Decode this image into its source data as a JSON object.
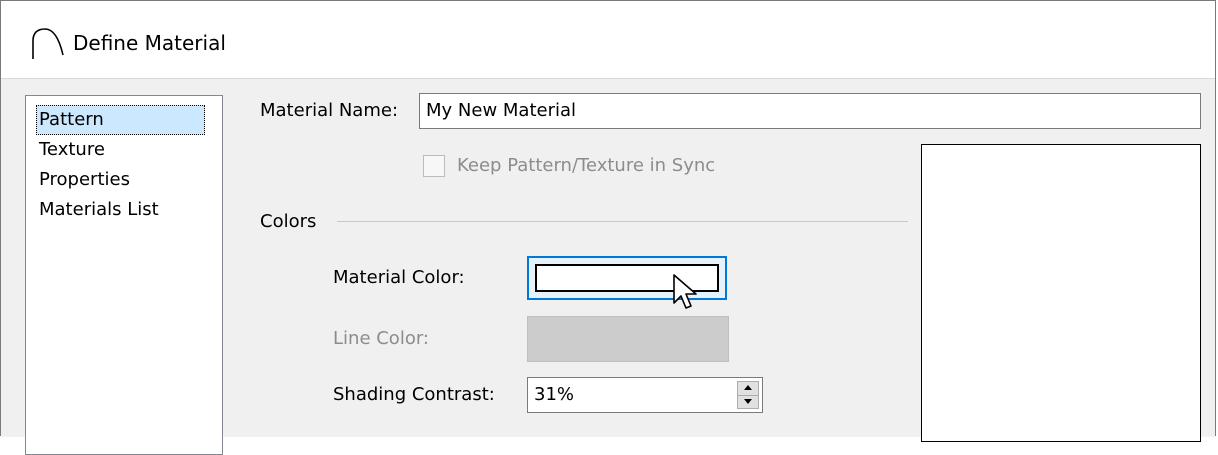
{
  "window": {
    "title": "Define Material",
    "icon": "arch-icon"
  },
  "nav": {
    "items": [
      {
        "label": "Pattern",
        "selected": true
      },
      {
        "label": "Texture",
        "selected": false
      },
      {
        "label": "Properties",
        "selected": false
      },
      {
        "label": "Materials List",
        "selected": false
      }
    ]
  },
  "form": {
    "material_name_label": "Material Name:",
    "material_name_value": "My New Material",
    "sync_checkbox_label": "Keep Pattern/Texture in Sync",
    "sync_checkbox_checked": false,
    "sync_checkbox_enabled": false
  },
  "colors": {
    "group_label": "Colors",
    "material_color_label": "Material Color:",
    "material_color_value": "#ffffff",
    "line_color_label": "Line Color:",
    "line_color_value": "#cccccc",
    "line_color_enabled": false,
    "shading_contrast_label": "Shading Contrast:",
    "shading_contrast_value": "31%"
  },
  "theme": {
    "accent": "#0078d7",
    "selection": "#cce8ff",
    "disabled_text": "#8c8c8c",
    "panel_background": "#f0f0f0"
  }
}
